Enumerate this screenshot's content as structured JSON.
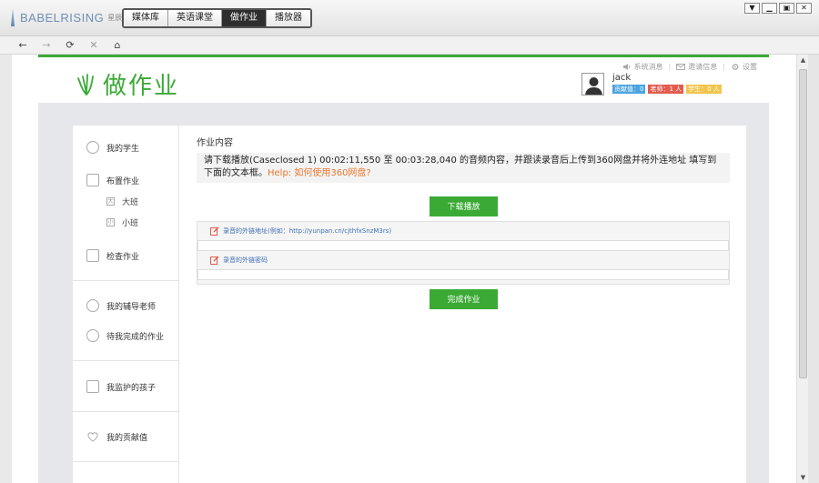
{
  "app": {
    "logo_text": "BABELRISING",
    "logo_sub": "星辰英语 · 英语…",
    "tabs": [
      "媒体库",
      "英语课堂",
      "做作业",
      "播放器"
    ],
    "active_tab": "做作业"
  },
  "window_controls": [
    "▼",
    "▁",
    "▣",
    "✕"
  ],
  "nav": {
    "back": "←",
    "forward": "→",
    "refresh": "⟳",
    "stop": "✕",
    "home": "⌂"
  },
  "header": {
    "title": "做作业",
    "links": {
      "messages": "系统消息",
      "invite": "邀请信息",
      "settings": "设置"
    },
    "user": {
      "name": "jack",
      "badges": {
        "contribution": "贡献值：0",
        "teachers": "老师：1 人",
        "students": "学生：0 人"
      }
    }
  },
  "sidebar": {
    "my_students": "我的学生",
    "assign_homework": "布置作业",
    "class_big": "大班",
    "class_small": "小班",
    "check_homework": "检查作业",
    "my_tutors": "我的辅导老师",
    "pending_homework": "待我完成的作业",
    "monitored_children": "我监护的孩子",
    "my_contribution": "我的贡献值"
  },
  "homework": {
    "section_title": "作业内容",
    "instruction": "请下载播放(Caseclosed 1) 00:02:11,550 至 00:03:28,040 的音频内容，并跟读录音后上传到360网盘并将外连地址 填写到下面的文本框。",
    "help_link": "Help: 如何使用360网盘?",
    "download_button": "下载播放",
    "link_label": "录音的外链地址(例如：http://yunpan.cn/cjthfxSnzM3rs)",
    "password_label": "录音的外链密码",
    "link_value": "",
    "password_value": "",
    "submit_button": "完成作业"
  },
  "colors": {
    "brand_green": "#3aaa35",
    "help_orange": "#e9782d",
    "label_blue": "#3f6fb5"
  }
}
